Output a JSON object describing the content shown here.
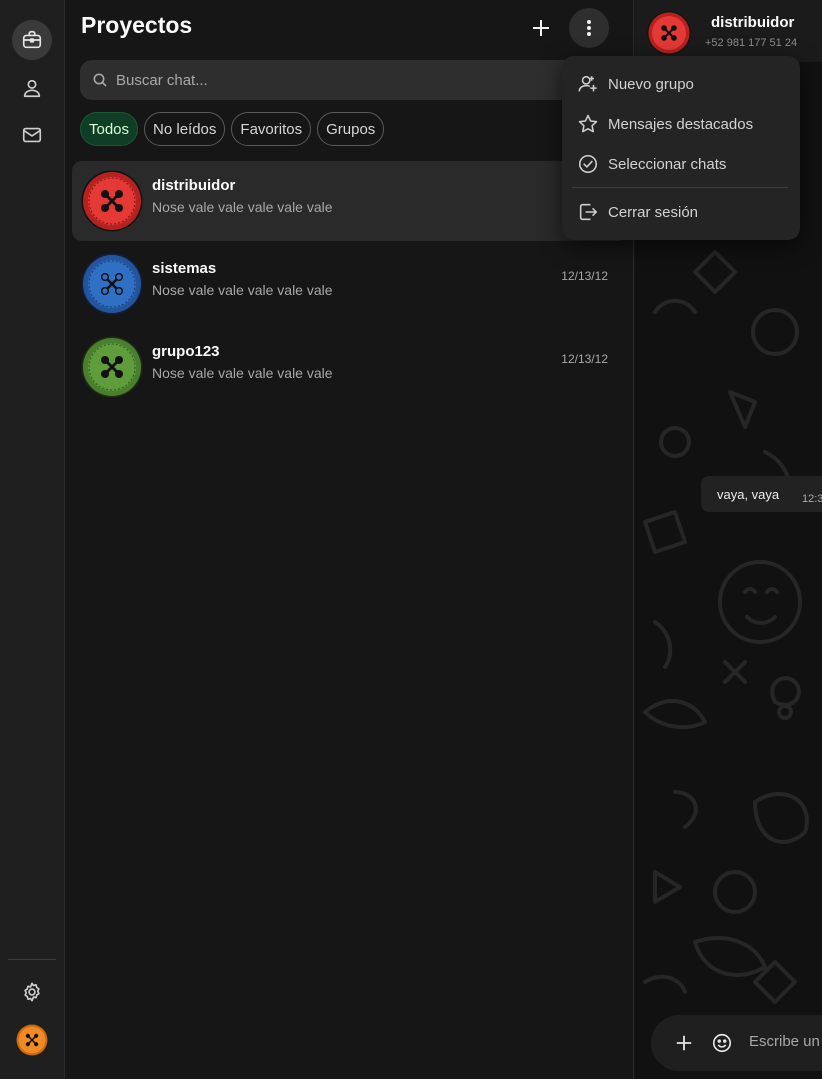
{
  "rail": {
    "items": [
      {
        "name": "projects",
        "icon": "briefcase-icon"
      },
      {
        "name": "contacts",
        "icon": "person-icon"
      },
      {
        "name": "mail",
        "icon": "mail-icon"
      }
    ],
    "settings_icon": "gear-icon",
    "profile_avatar": "button-avatar"
  },
  "list": {
    "title": "Proyectos",
    "add_icon": "plus-icon",
    "menu_icon": "kebab-menu-icon",
    "search_placeholder": "Buscar chat...",
    "filters": [
      "Todos",
      "No leídos",
      "Favoritos",
      "Grupos"
    ],
    "active_filter": "Todos",
    "chats": [
      {
        "name": "distribuidor",
        "preview": "Nose vale vale vale vale vale",
        "time": "",
        "color": "#e53935",
        "selected": true
      },
      {
        "name": "sistemas",
        "preview": "Nose vale vale vale vale vale",
        "time": "12/13/12",
        "color": "#2f6fc4",
        "selected": false
      },
      {
        "name": "grupo123",
        "preview": "Nose vale vale vale vale vale",
        "time": "12/13/12",
        "color": "#5e9c3c",
        "selected": false
      }
    ]
  },
  "menu": {
    "items": [
      {
        "label": "Nuevo grupo",
        "icon": "add-user-icon"
      },
      {
        "label": "Mensajes destacados",
        "icon": "star-icon"
      },
      {
        "label": "Seleccionar chats",
        "icon": "check-circle-icon"
      },
      {
        "label": "Cerrar sesión",
        "icon": "logout-icon"
      }
    ]
  },
  "conversation": {
    "contact_name": "distribuidor",
    "contact_phone": "+52 981 177 51 24",
    "messages": [
      {
        "text": "vaya, vaya",
        "time": "12:3"
      }
    ],
    "composer_placeholder": "Escribe un mensaje"
  },
  "colors": {
    "accent_green": "#103d26",
    "red_avatar": "#e53935",
    "blue_avatar": "#2f6fc4",
    "green_avatar": "#5e9c3c",
    "orange_avatar": "#f08a24"
  }
}
